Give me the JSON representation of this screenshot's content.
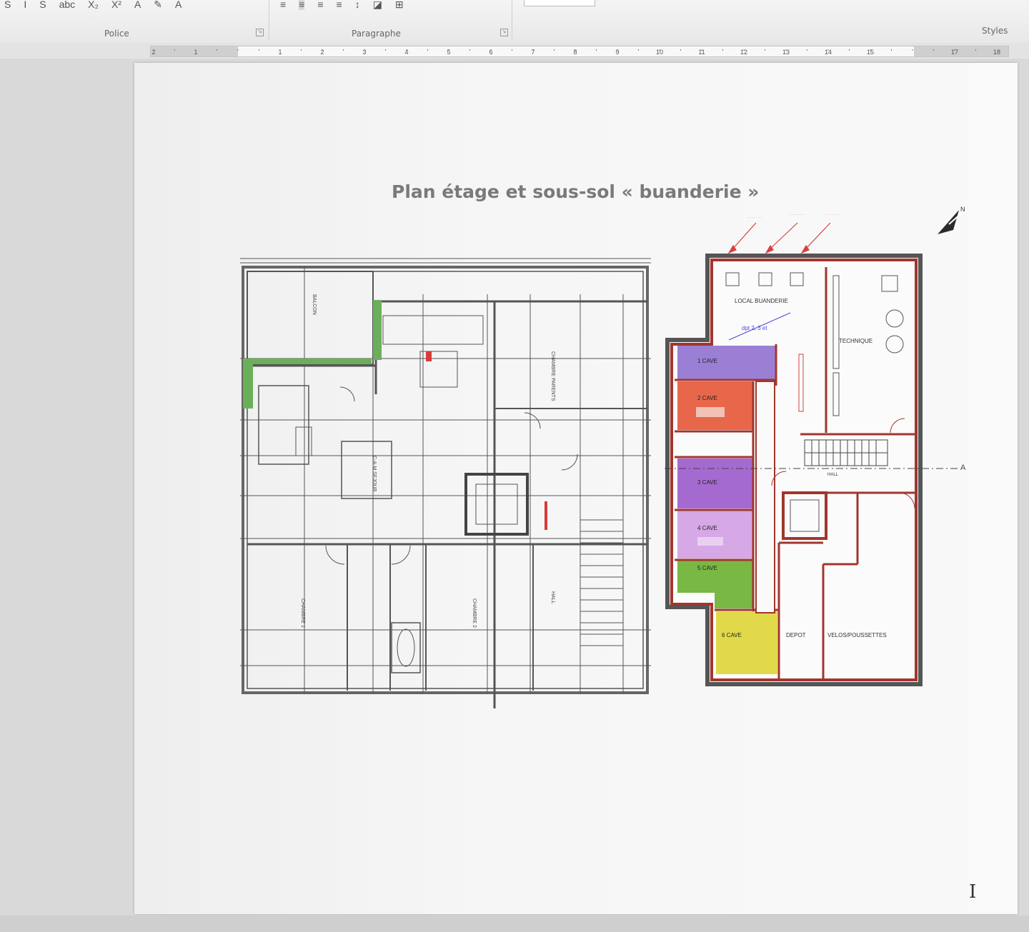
{
  "ribbon": {
    "top_icons": [
      "S",
      "I",
      "S",
      "abc",
      "X₂",
      "X²",
      "A",
      "✎",
      "A"
    ],
    "groups": {
      "police_label": "Police",
      "paragraphe_label": "Paragraphe",
      "styles_label": "Styles"
    }
  },
  "ruler": {
    "left_numbers": [
      "2",
      "1"
    ],
    "numbers": [
      "1",
      "2",
      "3",
      "4",
      "5",
      "6",
      "7",
      "8",
      "9",
      "10",
      "11",
      "12",
      "13",
      "14",
      "15",
      "17",
      "18"
    ]
  },
  "document": {
    "title": "Plan étage et sous-sol « buanderie »",
    "basement_rooms": {
      "local_buanderie": "LOCAL BUANDERIE",
      "local_buanderie_note": "dpt 2, 3 et",
      "technique": "TECHNIQUE",
      "cave_1": "1 CAVE",
      "cave_2": "2 CAVE",
      "cave_3": "3 CAVE",
      "cave_4": "4 CAVE",
      "cave_5": "5 CAVE",
      "cave_6": "6 CAVE",
      "hall": "HALL",
      "depot": "DEPOT",
      "velos": "VELOS/POUSSETTES",
      "section_mark": "A"
    },
    "floor_rooms": {
      "balcon": "BALCON",
      "cuisine_sejour": "C-A-M SEJOUR",
      "chambre_parents": "CHAMBRE PARENTS",
      "chambre_1": "CHAMBRE 1",
      "chambre_2": "CHAMBRE 2",
      "hall": "HALL"
    },
    "colors": {
      "cave_1": "#9b7fd4",
      "cave_2": "#e8674a",
      "cave_3": "#a56ad0",
      "cave_4": "#d6a8e6",
      "cave_5": "#78b843",
      "cave_6": "#e2d94a",
      "wall_red": "#a1362e",
      "green_wall": "#6caf5b"
    }
  }
}
